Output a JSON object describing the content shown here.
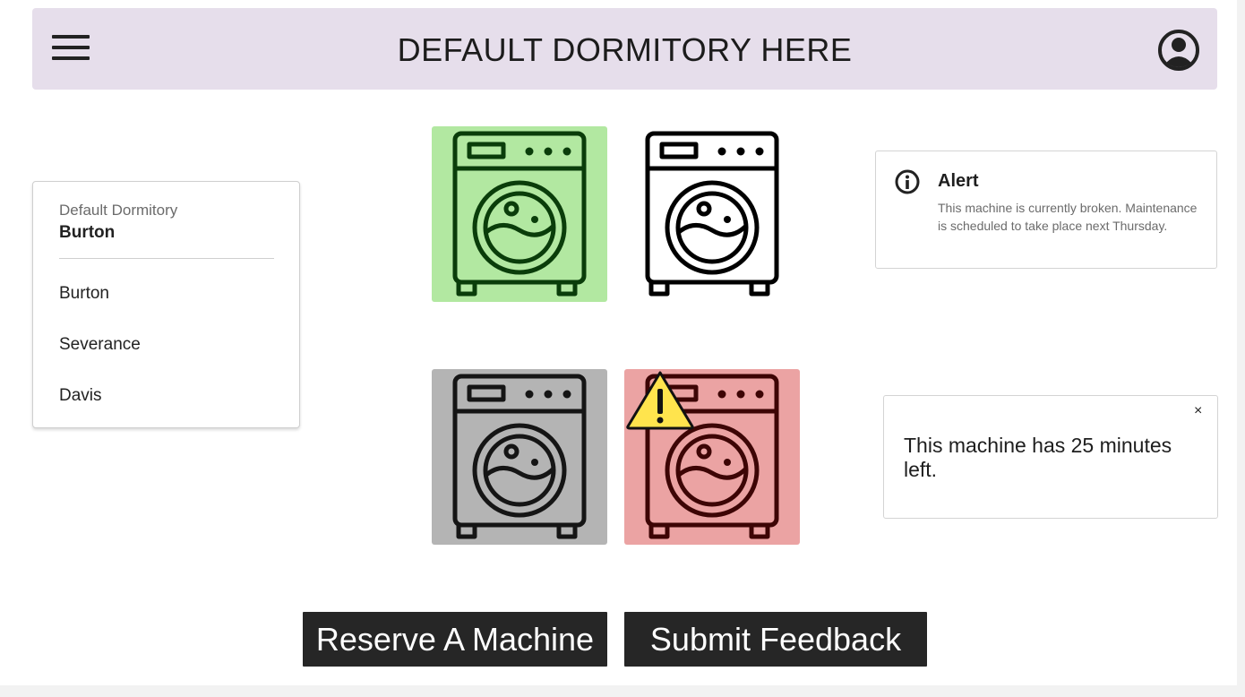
{
  "header": {
    "title": "DEFAULT DORMITORY HERE",
    "menu_icon": "hamburger-menu-icon",
    "account_icon": "account-circle-icon"
  },
  "dorm_selector": {
    "label": "Default Dormitory",
    "selected": "Burton",
    "options": [
      "Burton",
      "Severance",
      "Davis"
    ]
  },
  "machines": [
    {
      "status": "available",
      "color": "#b2e8a1",
      "icon_color": "#0a3d0a",
      "icon": "washing-machine-icon"
    },
    {
      "status": "selected",
      "color": "#ffffff",
      "icon_color": "#000000",
      "icon": "washing-machine-icon"
    },
    {
      "status": "in-use",
      "color": "#b4b4b4",
      "icon_color": "#151515",
      "icon": "washing-machine-icon"
    },
    {
      "status": "broken",
      "color": "#eba3a3",
      "icon_color": "#3d0505",
      "icon": "washing-machine-icon",
      "badge": "warning-triangle-icon"
    }
  ],
  "alert": {
    "title": "Alert",
    "body": "This machine is currently broken. Maintenance is scheduled to take place next Thursday.",
    "icon": "info-icon"
  },
  "toast": {
    "message": "This machine has 25 minutes left.",
    "close_label": "×"
  },
  "actions": {
    "reserve_label": "Reserve A Machine",
    "feedback_label": "Submit Feedback"
  }
}
